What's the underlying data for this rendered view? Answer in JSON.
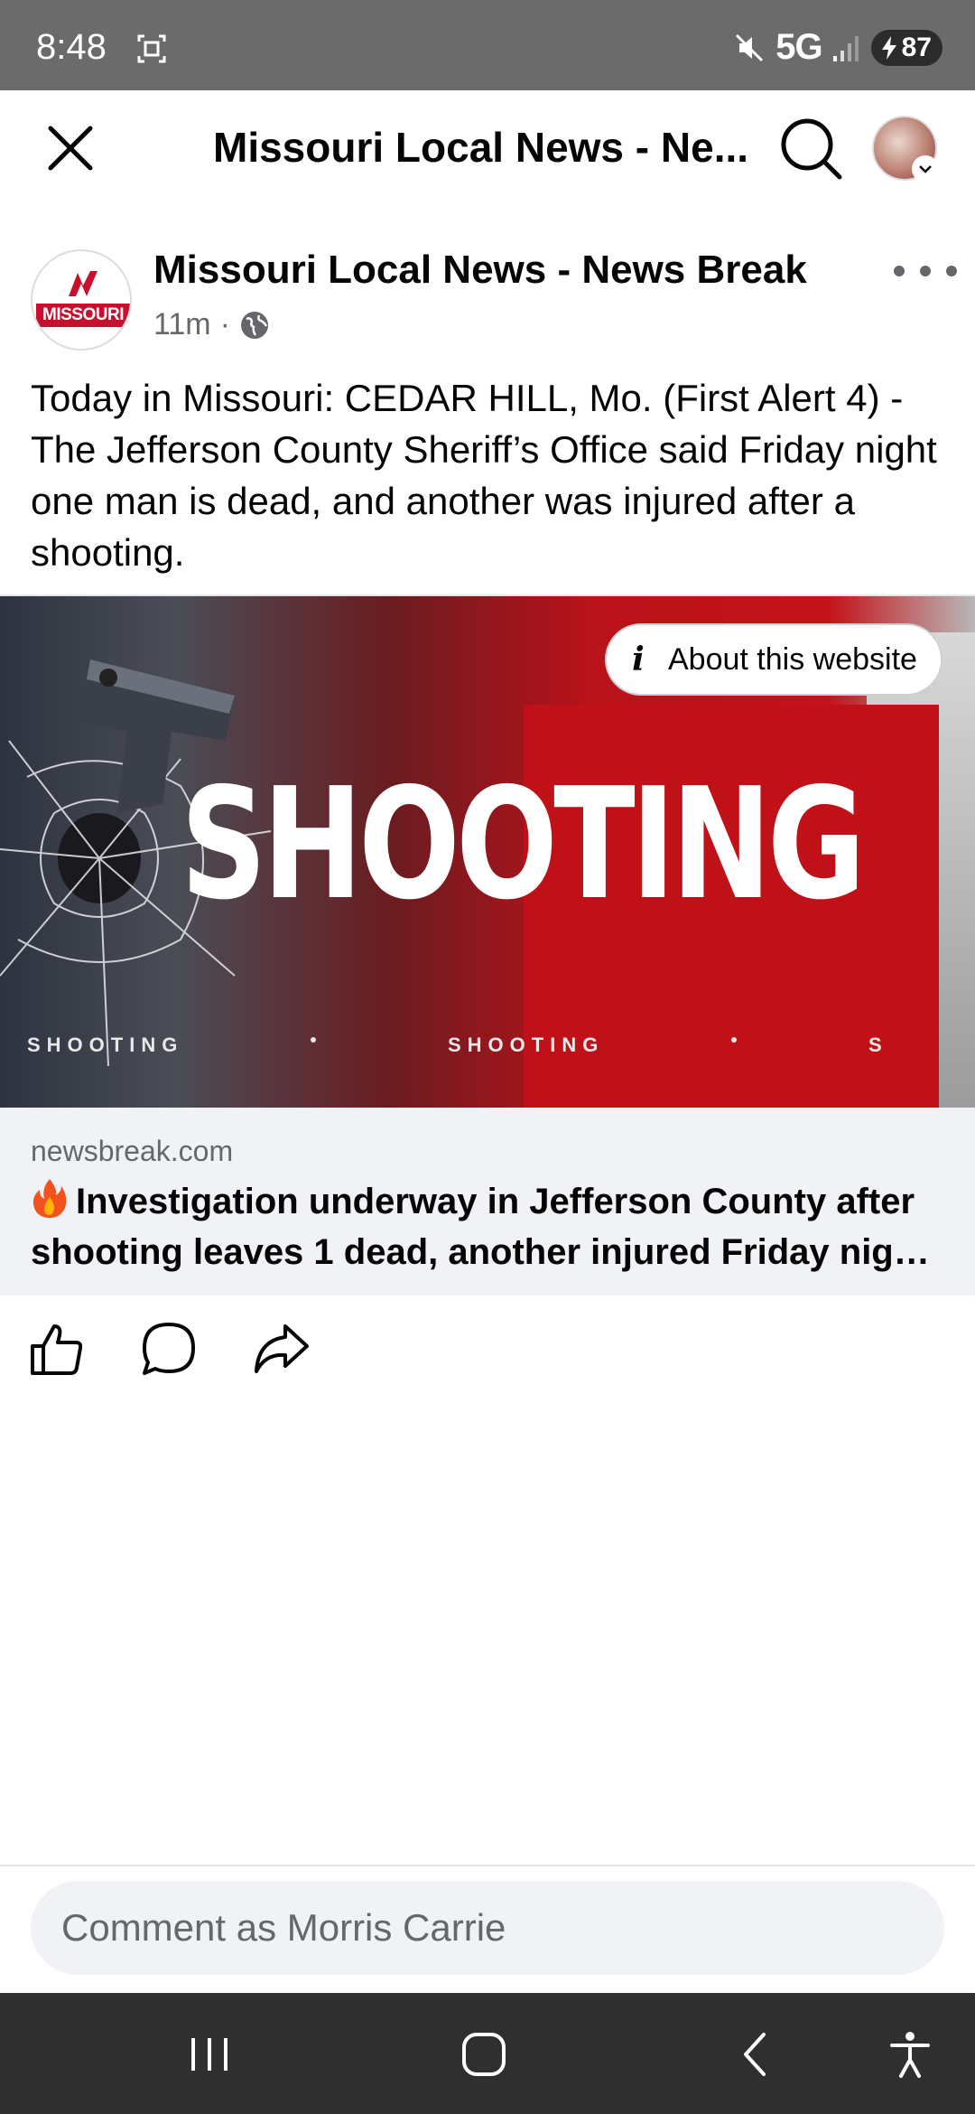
{
  "status_bar": {
    "time": "8:48",
    "network": "5G",
    "battery": "87"
  },
  "app_bar": {
    "title": "Missouri Local News - Ne..."
  },
  "post": {
    "page_name": "Missouri Local News - News Break",
    "logo_text": "MISSOURI",
    "age": "11m",
    "separator": "·",
    "text": "Today in Missouri: CEDAR HILL, Mo. (First Alert 4) - The Jefferson County Sheriff’s Office said Friday night one man is dead, and another was injured after a shooting."
  },
  "link": {
    "image_headline": "SHOOTING",
    "ticker_1": "SHOOTING",
    "ticker_2": "SHOOTING",
    "ticker_3": "S",
    "about_label": "About this website",
    "domain": "newsbreak.com",
    "title": "Investigation underway in Jefferson County after shooting leaves 1 dead, another injured Friday night ..."
  },
  "comment": {
    "placeholder": "Comment as Morris Carrie"
  },
  "colors": {
    "status_bar_bg": "#6b6b6b",
    "nav_bar_bg": "#2f2f2f",
    "brand_red": "#c8102e",
    "link_meta_bg": "#f0f2f5",
    "secondary_text": "#65676b"
  }
}
